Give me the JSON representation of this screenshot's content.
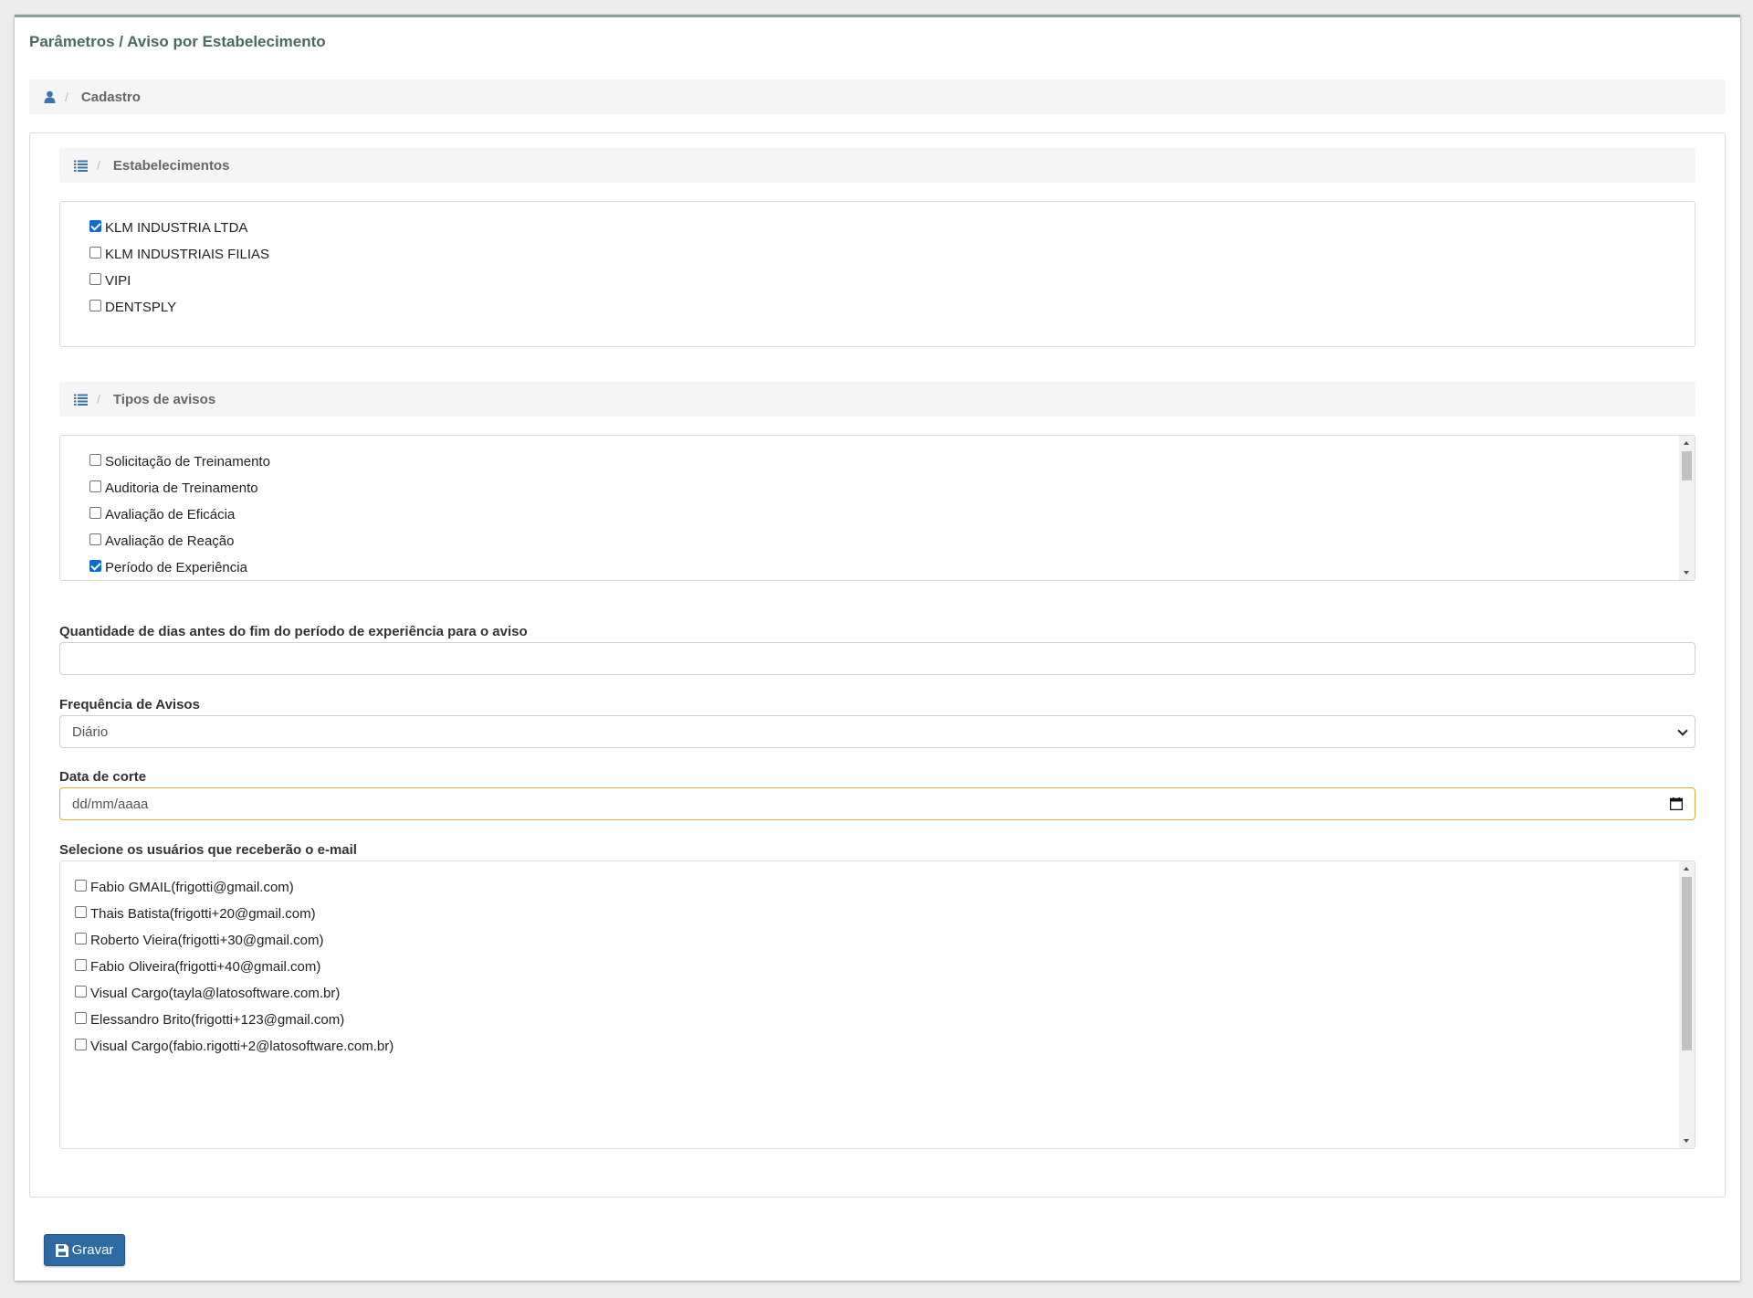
{
  "page": {
    "title": "Parâmetros / Aviso por Estabelecimento"
  },
  "breadcrumb": {
    "icon": "user-icon",
    "label": "Cadastro"
  },
  "establishments": {
    "header_icon": "list-icon",
    "header_label": "Estabelecimentos",
    "items": [
      {
        "label": "KLM INDUSTRIA LTDA",
        "checked": true
      },
      {
        "label": "KLM INDUSTRIAIS FILIAS",
        "checked": false
      },
      {
        "label": "VIPI",
        "checked": false
      },
      {
        "label": "DENTSPLY",
        "checked": false
      }
    ]
  },
  "notice_types": {
    "header_icon": "list-icon",
    "header_label": "Tipos de avisos",
    "items": [
      {
        "label": "Solicitação de Treinamento",
        "checked": false
      },
      {
        "label": "Auditoria de Treinamento",
        "checked": false
      },
      {
        "label": "Avaliação de Eficácia",
        "checked": false
      },
      {
        "label": "Avaliação de Reação",
        "checked": false
      },
      {
        "label": "Período de Experiência",
        "checked": true
      }
    ]
  },
  "days_field": {
    "label": "Quantidade de dias antes do fim do período de experiência para o aviso",
    "value": ""
  },
  "frequency_field": {
    "label": "Frequência de Avisos",
    "selected": "Diário"
  },
  "cutoff_date_field": {
    "label": "Data de corte",
    "placeholder": "dd/mm/aaaa",
    "icon": "calendar-icon"
  },
  "users": {
    "label": "Selecione os usuários que receberão o e-mail",
    "items": [
      {
        "label": "Fabio GMAIL(frigotti@gmail.com)",
        "checked": false
      },
      {
        "label": "Thais Batista(frigotti+20@gmail.com)",
        "checked": false
      },
      {
        "label": "Roberto Vieira(frigotti+30@gmail.com)",
        "checked": false
      },
      {
        "label": "Fabio Oliveira(frigotti+40@gmail.com)",
        "checked": false
      },
      {
        "label": "Visual Cargo(tayla@latosoftware.com.br)",
        "checked": false
      },
      {
        "label": "Elessandro Brito(frigotti+123@gmail.com)",
        "checked": false
      },
      {
        "label": "Visual Cargo(fabio.rigotti+2@latosoftware.com.br)",
        "checked": false
      }
    ]
  },
  "actions": {
    "save_label": "Gravar",
    "save_icon": "save-icon"
  },
  "colors": {
    "accent": "#2d6aa1",
    "title": "#4b6a5e",
    "focus_border": "#e4a833",
    "checkbox": "#0b6bd9"
  }
}
